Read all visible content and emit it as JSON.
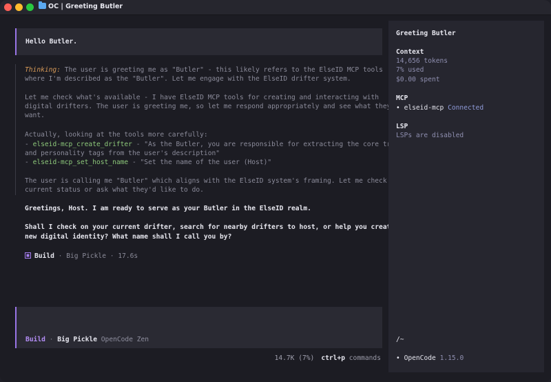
{
  "window": {
    "title": "OC | Greeting Butler"
  },
  "user_message": "Hello Butler.",
  "thinking": {
    "label": "Thinking:",
    "l1": "The user is greeting me as \"Butler\" - this likely refers to the ElseID MCP tools",
    "l2": "where I'm described as the \"Butler\". Let me engage with the ElseID drifter system.",
    "l3": "Let me check what's available - I have ElseID MCP tools for creating and interacting with",
    "l4": "digital drifters. The user is greeting me, so let me respond appropriately and see what they",
    "l5": "want.",
    "l6": "Actually, looking at the tools more carefully:",
    "l7_prefix": "- ",
    "l7_tool": "elseid-mcp_create_drifter",
    "l7_rest": " - \"As the Butler, you are responsible for extracting the core trait",
    "l8": "and personality tags from the user's description\"",
    "l9_prefix": "- ",
    "l9_tool": "elseid-mcp_set_host_name",
    "l9_rest": " - \"Set the name of the user (Host)\"",
    "l10": "The user is calling me \"Butler\" which aligns with the ElseID system's framing. Let me check the",
    "l11": "current status or ask what they'd like to do."
  },
  "response": {
    "p1": "Greetings, Host. I am ready to serve as your Butler in the ElseID realm.",
    "p2a": "Shall I check on your current drifter, search for nearby drifters to host, or help you create a",
    "p2b": "new digital identity? What name shall I call you by?"
  },
  "build_meta": {
    "mode": "Build",
    "sep1": " · ",
    "model": "Big Pickle",
    "sep2": " · ",
    "duration": "17.6s"
  },
  "input": {
    "mode": "Build",
    "sep": " · ",
    "model": "Big Pickle",
    "provider": "OpenCode Zen"
  },
  "status": {
    "tokens": "14.7K (7%)",
    "shortcut": "ctrl+p",
    "shortcut_label": "commands"
  },
  "sidebar": {
    "title": "Greeting Butler",
    "context_heading": "Context",
    "tokens": "14,656 tokens",
    "used": "7% used",
    "spent": "$0.00 spent",
    "mcp_heading": "MCP",
    "mcp_bullet": "•",
    "mcp_name": "elseid-mcp",
    "mcp_status": "Connected",
    "lsp_heading": "LSP",
    "lsp_status": "LSPs are disabled",
    "cwd": "/~",
    "app_bullet": "•",
    "app_name": "OpenCode",
    "app_version": "1.15.0"
  },
  "colors": {
    "accent": "#9a75e8",
    "thinking_label": "#d79a58",
    "tool_name": "#8dc87a",
    "mcp_connected": "#8f9ad8"
  }
}
